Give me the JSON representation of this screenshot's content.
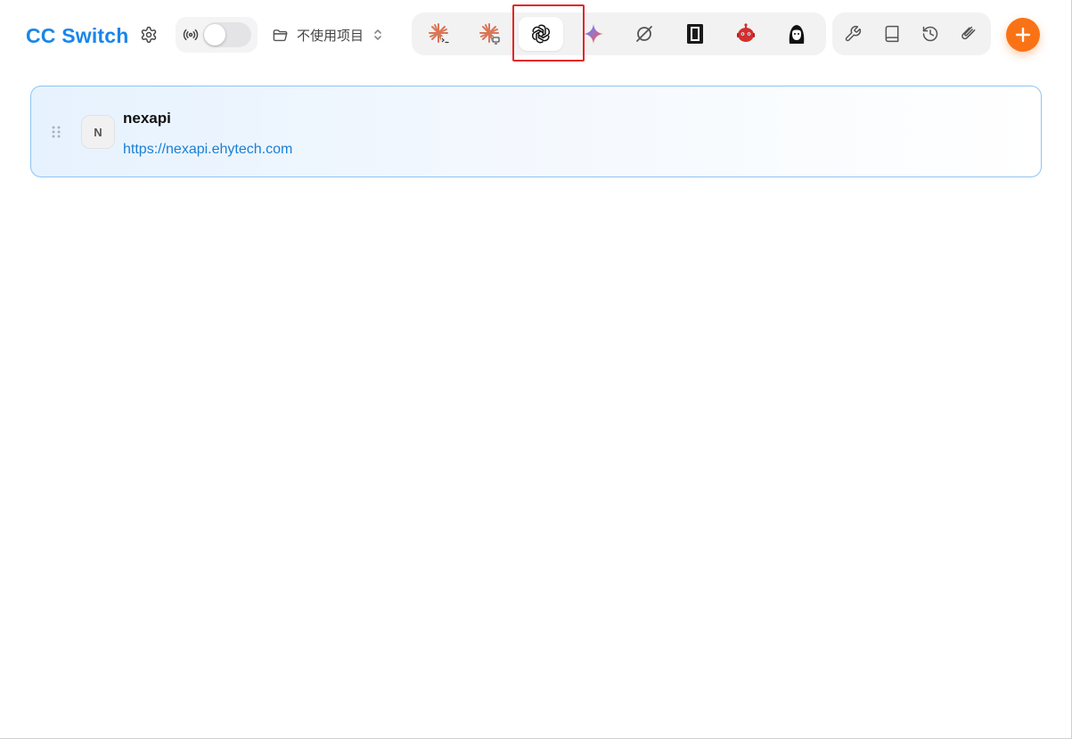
{
  "header": {
    "app_title": "CC Switch",
    "settings_icon": "gear-icon",
    "proxy": {
      "icon": "broadcast-icon",
      "enabled": false
    },
    "project_selector": {
      "icon": "folder-icon",
      "value": "不使用项目",
      "chevron": "chevron-updown-icon"
    },
    "apps": [
      {
        "id": "claude-code",
        "icon": "claude-code-icon",
        "active": false
      },
      {
        "id": "claude-desktop",
        "icon": "claude-desktop-icon",
        "active": false
      },
      {
        "id": "codex",
        "icon": "openai-icon",
        "active": true
      },
      {
        "id": "gemini",
        "icon": "gemini-icon",
        "active": false
      },
      {
        "id": "opencode",
        "icon": "orbit-icon",
        "active": false
      },
      {
        "id": "ide",
        "icon": "terminal-icon",
        "active": false
      },
      {
        "id": "robot",
        "icon": "robot-icon",
        "active": false
      },
      {
        "id": "character",
        "icon": "character-icon",
        "active": false
      }
    ],
    "utilities": [
      {
        "id": "tools",
        "icon": "wrench-icon"
      },
      {
        "id": "docs",
        "icon": "book-icon"
      },
      {
        "id": "history",
        "icon": "history-icon"
      },
      {
        "id": "attach",
        "icon": "paperclip-icon"
      }
    ],
    "add_icon": "plus-icon",
    "colors": {
      "accent": "#1a86e8",
      "add": "#f97316",
      "highlight": "#e32626"
    }
  },
  "providers": [
    {
      "avatar_letter": "N",
      "name": "nexapi",
      "url": "https://nexapi.ehytech.com",
      "selected": true
    }
  ]
}
